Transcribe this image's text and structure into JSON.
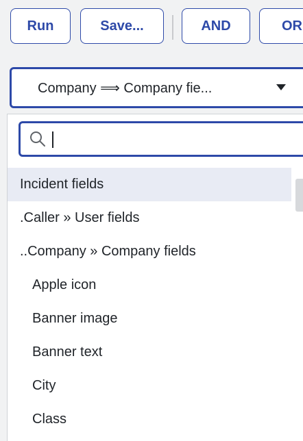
{
  "toolbar": {
    "run_label": "Run",
    "save_label": "Save...",
    "and_label": "AND",
    "or_label": "OR"
  },
  "field_select": {
    "value": "Company ⟹ Company fie..."
  },
  "dropdown": {
    "search_value": "",
    "options": [
      {
        "label": "Incident fields",
        "kind": "group"
      },
      {
        "label": ".Caller » User fields",
        "kind": "group"
      },
      {
        "label": "..Company » Company fields",
        "kind": "group"
      },
      {
        "label": "Apple icon",
        "kind": "field"
      },
      {
        "label": "Banner image",
        "kind": "field"
      },
      {
        "label": "Banner text",
        "kind": "field"
      },
      {
        "label": "City",
        "kind": "field"
      },
      {
        "label": "Class",
        "kind": "field"
      }
    ]
  },
  "colors": {
    "accent": "#2d49a8",
    "highlight": "#e8ebf4",
    "text": "#1f2328"
  },
  "icons": {
    "search": "search-icon",
    "caret": "caret-down-icon"
  }
}
